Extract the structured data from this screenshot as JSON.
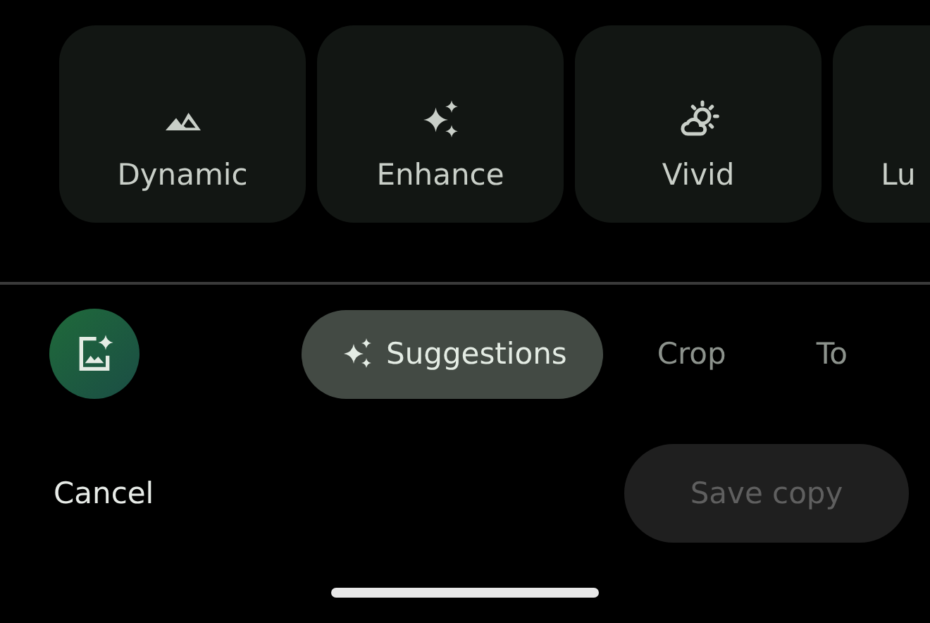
{
  "presets": [
    {
      "label": "Dynamic",
      "kind": "mountain"
    },
    {
      "label": "Enhance",
      "kind": "sparkles"
    },
    {
      "label": "Vivid",
      "kind": "weather"
    },
    {
      "label": "Lu"
    }
  ],
  "tabs": [
    {
      "label": "Suggestions",
      "selected": true
    },
    {
      "label": "Crop",
      "selected": false
    },
    {
      "label": "To",
      "selected": false
    }
  ],
  "actions": {
    "cancel": "Cancel",
    "save": {
      "label": "Save copy",
      "disabled": true
    }
  }
}
